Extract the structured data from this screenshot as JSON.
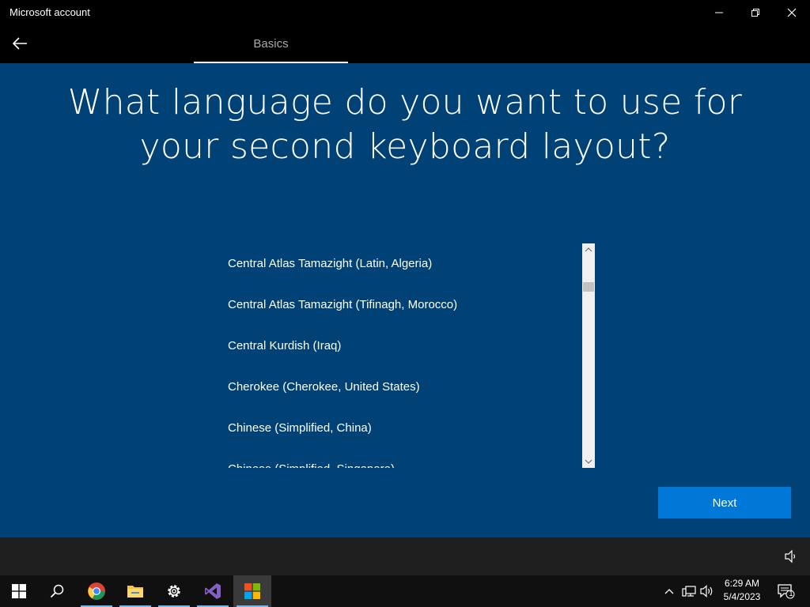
{
  "window": {
    "title": "Microsoft account"
  },
  "nav": {
    "tab_label": "Basics"
  },
  "main": {
    "heading": "What language do you want to use for your second keyboard layout?",
    "languages": [
      "Central Atlas Tamazight (Latin, Algeria)",
      "Central Atlas Tamazight (Tifinagh, Morocco)",
      "Central Kurdish (Iraq)",
      "Cherokee (Cherokee, United States)",
      "Chinese (Simplified, China)",
      "Chinese (Simplified, Singapore)"
    ],
    "next_label": "Next"
  },
  "taskbar": {
    "time": "6:29 AM",
    "date": "5/4/2023",
    "notification_count": "1"
  },
  "colors": {
    "main_bg": "#004275",
    "accent": "#0078d7"
  }
}
